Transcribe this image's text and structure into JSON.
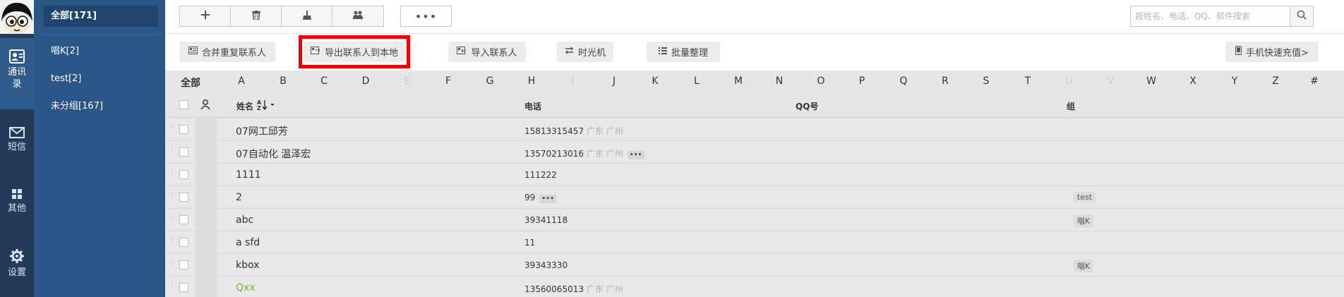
{
  "rail": {
    "items": [
      {
        "label": "通讯录",
        "icon": "contacts-icon"
      },
      {
        "label": "短信",
        "icon": "mail-icon"
      },
      {
        "label": "其他",
        "icon": "grid-icon"
      },
      {
        "label": "设置",
        "icon": "gear-icon"
      }
    ]
  },
  "groups": [
    {
      "label": "全部[171]"
    },
    {
      "label": "唱K[2]"
    },
    {
      "label": "test[2]"
    },
    {
      "label": "未分组[167]"
    }
  ],
  "toolbar": {
    "more_label": "•••",
    "search_placeholder": "按姓名、电话、QQ、邮件搜索"
  },
  "actions": {
    "merge": "合并重复联系人",
    "export": "导出联系人到本地",
    "import": "导入联系人",
    "timemachine": "时光机",
    "batch": "批量整理",
    "recharge": "手机快速充值>"
  },
  "alphabet": {
    "all": "全部",
    "letters": [
      "A",
      "B",
      "C",
      "D",
      "E",
      "F",
      "G",
      "H",
      "I",
      "J",
      "K",
      "L",
      "M",
      "N",
      "O",
      "P",
      "Q",
      "R",
      "S",
      "T",
      "U",
      "V",
      "W",
      "X",
      "Y",
      "Z",
      "#"
    ],
    "disabled": [
      "E",
      "I",
      "U",
      "V"
    ]
  },
  "table": {
    "headers": {
      "name": "姓名",
      "phone": "电话",
      "qq": "QQ号",
      "group": "组"
    },
    "rows": [
      {
        "name": "07网工邱芳",
        "phone": "15813315457",
        "location": "广东 广州",
        "more": false,
        "group": ""
      },
      {
        "name": "07自动化 温泽宏",
        "phone": "13570213016",
        "location": "广东 广州",
        "more": true,
        "group": ""
      },
      {
        "name": "1111",
        "phone": "111222",
        "location": "",
        "more": false,
        "group": ""
      },
      {
        "name": "2",
        "phone": "99",
        "location": "",
        "more": true,
        "group": "test"
      },
      {
        "name": "abc",
        "phone": "39341118",
        "location": "",
        "more": false,
        "group": "唱K"
      },
      {
        "name": "a sfd",
        "phone": "11",
        "location": "",
        "more": false,
        "group": ""
      },
      {
        "name": "kbox",
        "phone": "39343330",
        "location": "",
        "more": false,
        "group": "唱K"
      },
      {
        "name": "Qxx",
        "phone": "13560065013",
        "location": "广东 广州",
        "more": false,
        "group": "",
        "highlight": true
      }
    ]
  }
}
